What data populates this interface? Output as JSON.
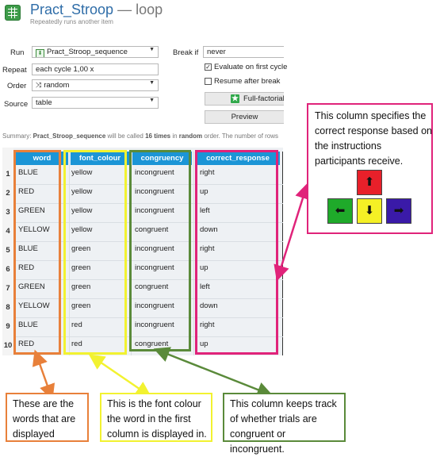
{
  "header": {
    "title": "Pract_Stroop",
    "title_suffix": " — loop",
    "subtitle": "Repeatedly runs another item"
  },
  "form": {
    "run_label": "Run",
    "run_value": "Pract_Stroop_sequence",
    "repeat_label": "Repeat",
    "repeat_value": "each cycle 1,00 x",
    "order_label": "Order",
    "order_value": "random",
    "source_label": "Source",
    "source_value": "table",
    "break_if_label": "Break if",
    "break_if_value": "never",
    "evaluate_first_label": "Evaluate on first cycle",
    "evaluate_first_checked": true,
    "resume_label": "Resume after break",
    "resume_checked": false,
    "full_factorial_label": "Full-factorial d",
    "preview_label": "Preview"
  },
  "summary": {
    "prefix": "Summary: ",
    "sequence": "Pract_Stroop_sequence",
    "mid1": " will be called ",
    "times": "16 times",
    "mid2": " in ",
    "order": "random",
    "suffix": " order. The number of rows"
  },
  "table": {
    "columns": [
      "word",
      "font_colour",
      "congruency",
      "correct_response"
    ],
    "row_numbers": [
      "1",
      "2",
      "3",
      "4",
      "5",
      "6",
      "7",
      "8",
      "9",
      "10"
    ],
    "rows": [
      [
        "BLUE",
        "yellow",
        "incongruent",
        "right"
      ],
      [
        "RED",
        "yellow",
        "incongruent",
        "up"
      ],
      [
        "GREEN",
        "yellow",
        "incongruent",
        "left"
      ],
      [
        "YELLOW",
        "yellow",
        "congruent",
        "down"
      ],
      [
        "BLUE",
        "green",
        "incongruent",
        "right"
      ],
      [
        "RED",
        "green",
        "incongruent",
        "up"
      ],
      [
        "GREEN",
        "green",
        "congruent",
        "left"
      ],
      [
        "YELLOW",
        "green",
        "incongruent",
        "down"
      ],
      [
        "BLUE",
        "red",
        "incongruent",
        "right"
      ],
      [
        "RED",
        "red",
        "congruent",
        "up"
      ]
    ]
  },
  "callouts": {
    "correct_response": "This column specifies the correct response based on the instructions participants receive.",
    "word": "These are the words that are displayed",
    "font_colour": "This is the font colour the word in the first column is displayed in.",
    "congruency": "This column keeps track of whether trials are congruent or incongruent."
  },
  "colors": {
    "word_outline": "#e8803a",
    "font_colour_outline": "#f2f230",
    "congruency_outline": "#5a8a3a",
    "correct_response_outline": "#e0237a",
    "header_blue": "#1b95d6",
    "key_up": "#e8202a",
    "key_left": "#1faa2a",
    "key_down": "#f5f025",
    "key_right": "#3a1aa8"
  },
  "icons": {
    "app": "table-icon",
    "key_up": "arrow-up-icon",
    "key_left": "arrow-left-icon",
    "key_down": "arrow-down-icon",
    "key_right": "arrow-right-icon"
  }
}
